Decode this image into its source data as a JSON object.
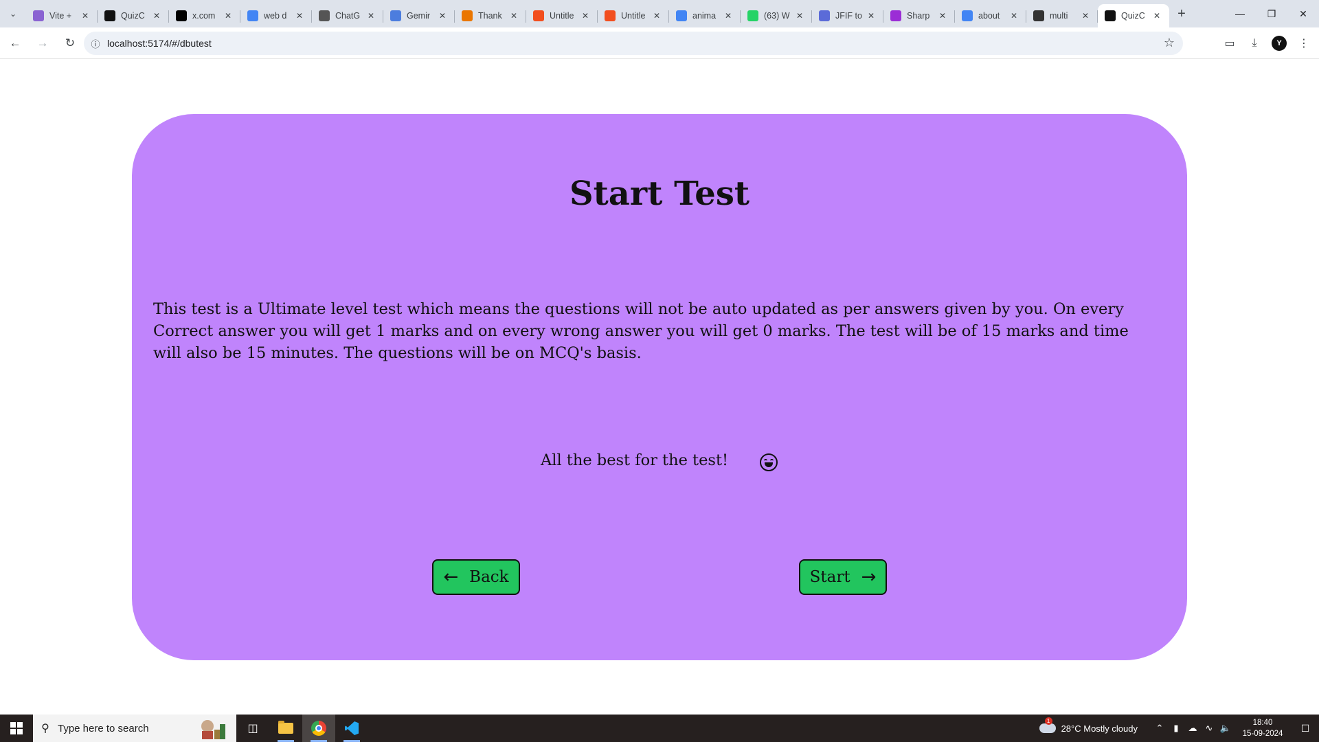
{
  "browser": {
    "tabs": [
      {
        "label": "Vite +",
        "icon": "vite-icon",
        "color": "#8a63d2"
      },
      {
        "label": "QuizC",
        "icon": "quiz-icon",
        "color": "#111111"
      },
      {
        "label": "x.com",
        "icon": "x-icon",
        "color": "#000000"
      },
      {
        "label": "web d",
        "icon": "google-icon",
        "color": "#4285f4"
      },
      {
        "label": "ChatG",
        "icon": "chatgpt-icon",
        "color": "#555555"
      },
      {
        "label": "Gemir",
        "icon": "gemini-icon",
        "color": "#4c7dde"
      },
      {
        "label": "Thank",
        "icon": "blender-icon",
        "color": "#ea7600"
      },
      {
        "label": "Untitle",
        "icon": "figma-icon",
        "color": "#f24e1e"
      },
      {
        "label": "Untitle",
        "icon": "figma-icon",
        "color": "#f24e1e"
      },
      {
        "label": "anima",
        "icon": "google-icon",
        "color": "#4285f4"
      },
      {
        "label": "(63) W",
        "icon": "whatsapp-icon",
        "color": "#25d366"
      },
      {
        "label": "JFIF to",
        "icon": "converter-icon",
        "color": "#5b6bd8"
      },
      {
        "label": "Sharp",
        "icon": "picsart-icon",
        "color": "#9b2dd6"
      },
      {
        "label": "about",
        "icon": "google-icon",
        "color": "#4285f4"
      },
      {
        "label": "multi",
        "icon": "openai-icon",
        "color": "#333333"
      },
      {
        "label": "QuizC",
        "icon": "quiz-icon",
        "color": "#111111",
        "active": true
      }
    ],
    "url": "localhost:5174/#/dbutest",
    "profile_initial": "Y"
  },
  "page": {
    "title": "Start Test",
    "description": "This test is a Ultimate level test which means the questions will not be auto updated as per answers given by you. On every Correct answer you will get 1 marks and on every wrong answer you will get 0 marks. The test will be of 15 marks and time will also be 15 minutes. The questions will be on MCQ's basis.",
    "wish": "All the best for the test!",
    "back_label": "Back",
    "start_label": "Start",
    "card_color": "#c084fc",
    "button_color": "#22c55e"
  },
  "taskbar": {
    "search_placeholder": "Type here to search",
    "weather": "28°C  Mostly cloudy",
    "weather_badge": "1",
    "time": "18:40",
    "date": "15-09-2024"
  }
}
